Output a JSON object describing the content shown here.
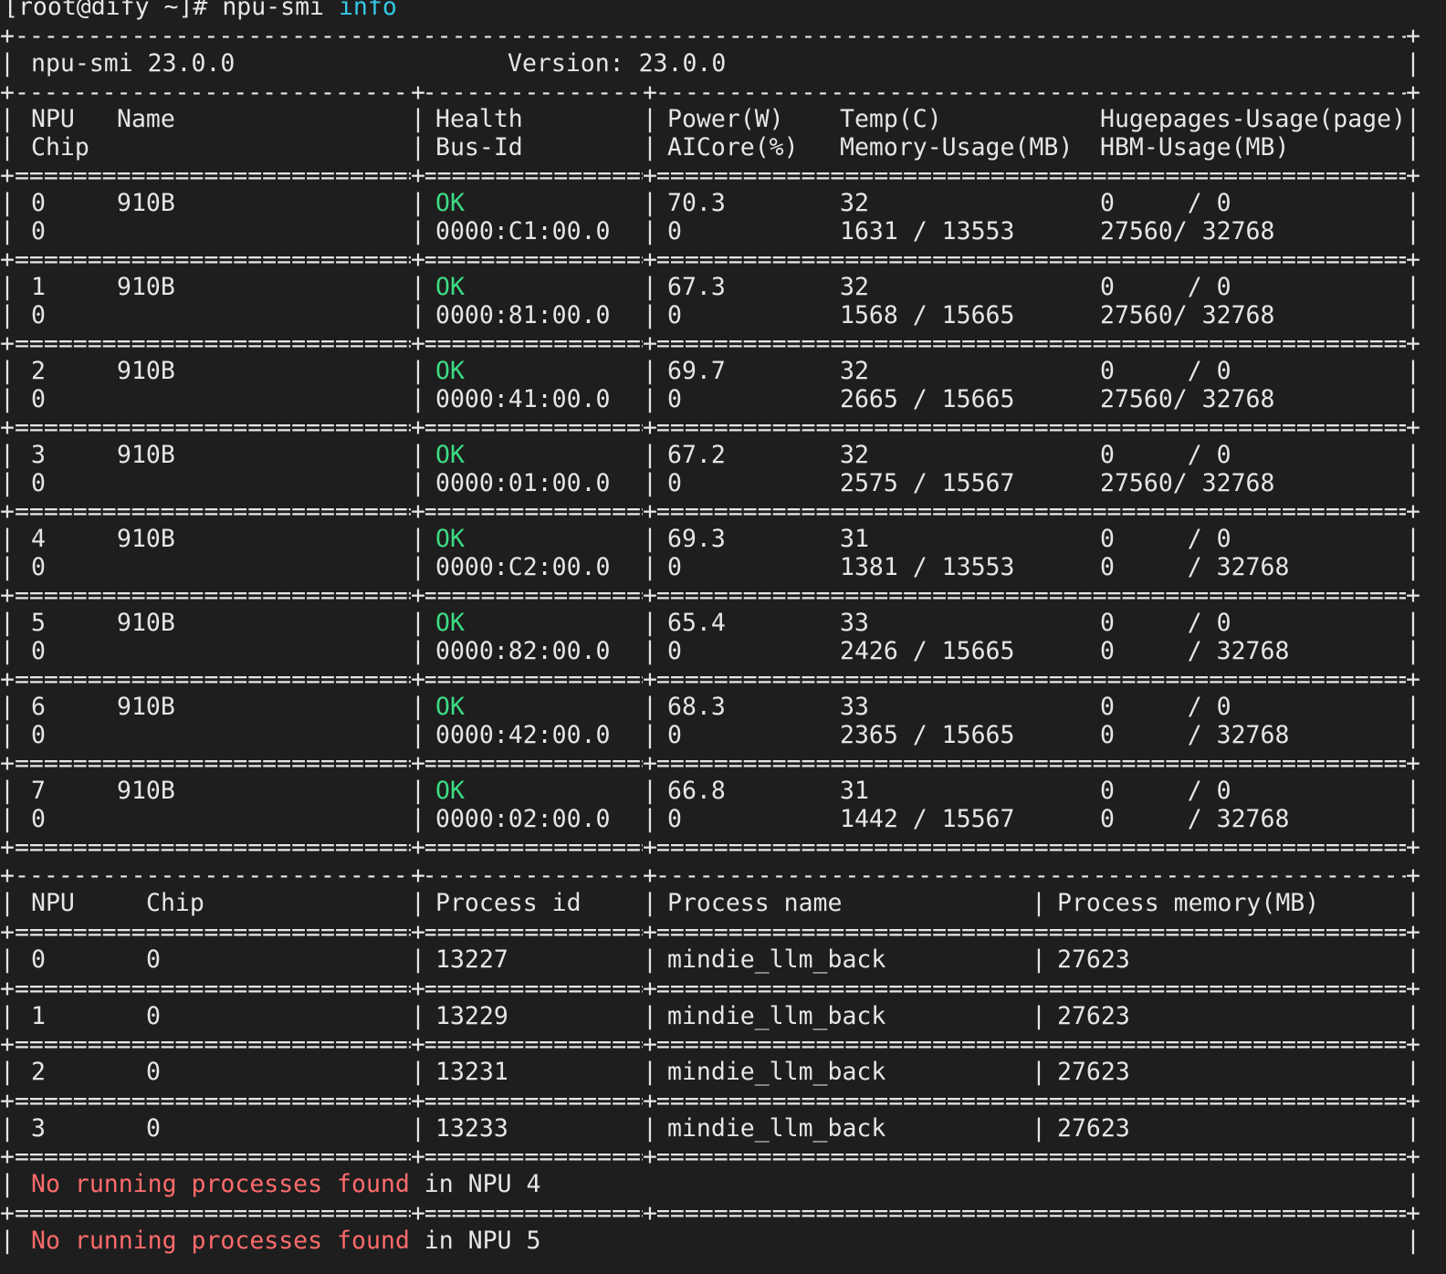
{
  "prompt": {
    "text": "[root@dify ~]# npu-smi ",
    "arg": "info"
  },
  "header": {
    "tool": "npu-smi 23.0.0",
    "version": "Version: 23.0.0"
  },
  "columns": {
    "row1": [
      "NPU",
      "Name",
      "Health",
      "Power(W)",
      "Temp(C)",
      "Hugepages-Usage(page)"
    ],
    "row2": [
      "Chip",
      "Bus-Id",
      "AICore(%)",
      "Memory-Usage(MB)",
      "HBM-Usage(MB)"
    ]
  },
  "npus": [
    {
      "npu": "0",
      "name": "910B",
      "health": "OK",
      "power": "70.3",
      "temp": "32",
      "huge": "0     / 0",
      "chip": "0",
      "bus": "0000:C1:00.0",
      "aicore": "0",
      "mem": "1631 / 13553",
      "hbm": "27560/ 32768"
    },
    {
      "npu": "1",
      "name": "910B",
      "health": "OK",
      "power": "67.3",
      "temp": "32",
      "huge": "0     / 0",
      "chip": "0",
      "bus": "0000:81:00.0",
      "aicore": "0",
      "mem": "1568 / 15665",
      "hbm": "27560/ 32768"
    },
    {
      "npu": "2",
      "name": "910B",
      "health": "OK",
      "power": "69.7",
      "temp": "32",
      "huge": "0     / 0",
      "chip": "0",
      "bus": "0000:41:00.0",
      "aicore": "0",
      "mem": "2665 / 15665",
      "hbm": "27560/ 32768"
    },
    {
      "npu": "3",
      "name": "910B",
      "health": "OK",
      "power": "67.2",
      "temp": "32",
      "huge": "0     / 0",
      "chip": "0",
      "bus": "0000:01:00.0",
      "aicore": "0",
      "mem": "2575 / 15567",
      "hbm": "27560/ 32768"
    },
    {
      "npu": "4",
      "name": "910B",
      "health": "OK",
      "power": "69.3",
      "temp": "31",
      "huge": "0     / 0",
      "chip": "0",
      "bus": "0000:C2:00.0",
      "aicore": "0",
      "mem": "1381 / 13553",
      "hbm": "0     / 32768"
    },
    {
      "npu": "5",
      "name": "910B",
      "health": "OK",
      "power": "65.4",
      "temp": "33",
      "huge": "0     / 0",
      "chip": "0",
      "bus": "0000:82:00.0",
      "aicore": "0",
      "mem": "2426 / 15665",
      "hbm": "0     / 32768"
    },
    {
      "npu": "6",
      "name": "910B",
      "health": "OK",
      "power": "68.3",
      "temp": "33",
      "huge": "0     / 0",
      "chip": "0",
      "bus": "0000:42:00.0",
      "aicore": "0",
      "mem": "2365 / 15665",
      "hbm": "0     / 32768"
    },
    {
      "npu": "7",
      "name": "910B",
      "health": "OK",
      "power": "66.8",
      "temp": "31",
      "huge": "0     / 0",
      "chip": "0",
      "bus": "0000:02:00.0",
      "aicore": "0",
      "mem": "1442 / 15567",
      "hbm": "0     / 32768"
    }
  ],
  "proc_columns": [
    "NPU",
    "Chip",
    "Process id",
    "Process name",
    "Process memory(MB)"
  ],
  "processes": [
    {
      "npu": "0",
      "chip": "0",
      "pid": "13227",
      "name": "mindie_llm_back",
      "mem": "27623"
    },
    {
      "npu": "1",
      "chip": "0",
      "pid": "13229",
      "name": "mindie_llm_back",
      "mem": "27623"
    },
    {
      "npu": "2",
      "chip": "0",
      "pid": "13231",
      "name": "mindie_llm_back",
      "mem": "27623"
    },
    {
      "npu": "3",
      "chip": "0",
      "pid": "13233",
      "name": "mindie_llm_back",
      "mem": "27623"
    }
  ],
  "no_process": [
    {
      "msg": "No running processes found",
      "suffix": " in NPU 4"
    },
    {
      "msg": "No running processes found",
      "suffix": " in NPU 5"
    }
  ],
  "colors": {
    "background": "#1e1e1e",
    "text": "#e6e6e6",
    "ok": "#3ddc84",
    "error": "#ff6b6b",
    "arg": "#35c8e6"
  }
}
